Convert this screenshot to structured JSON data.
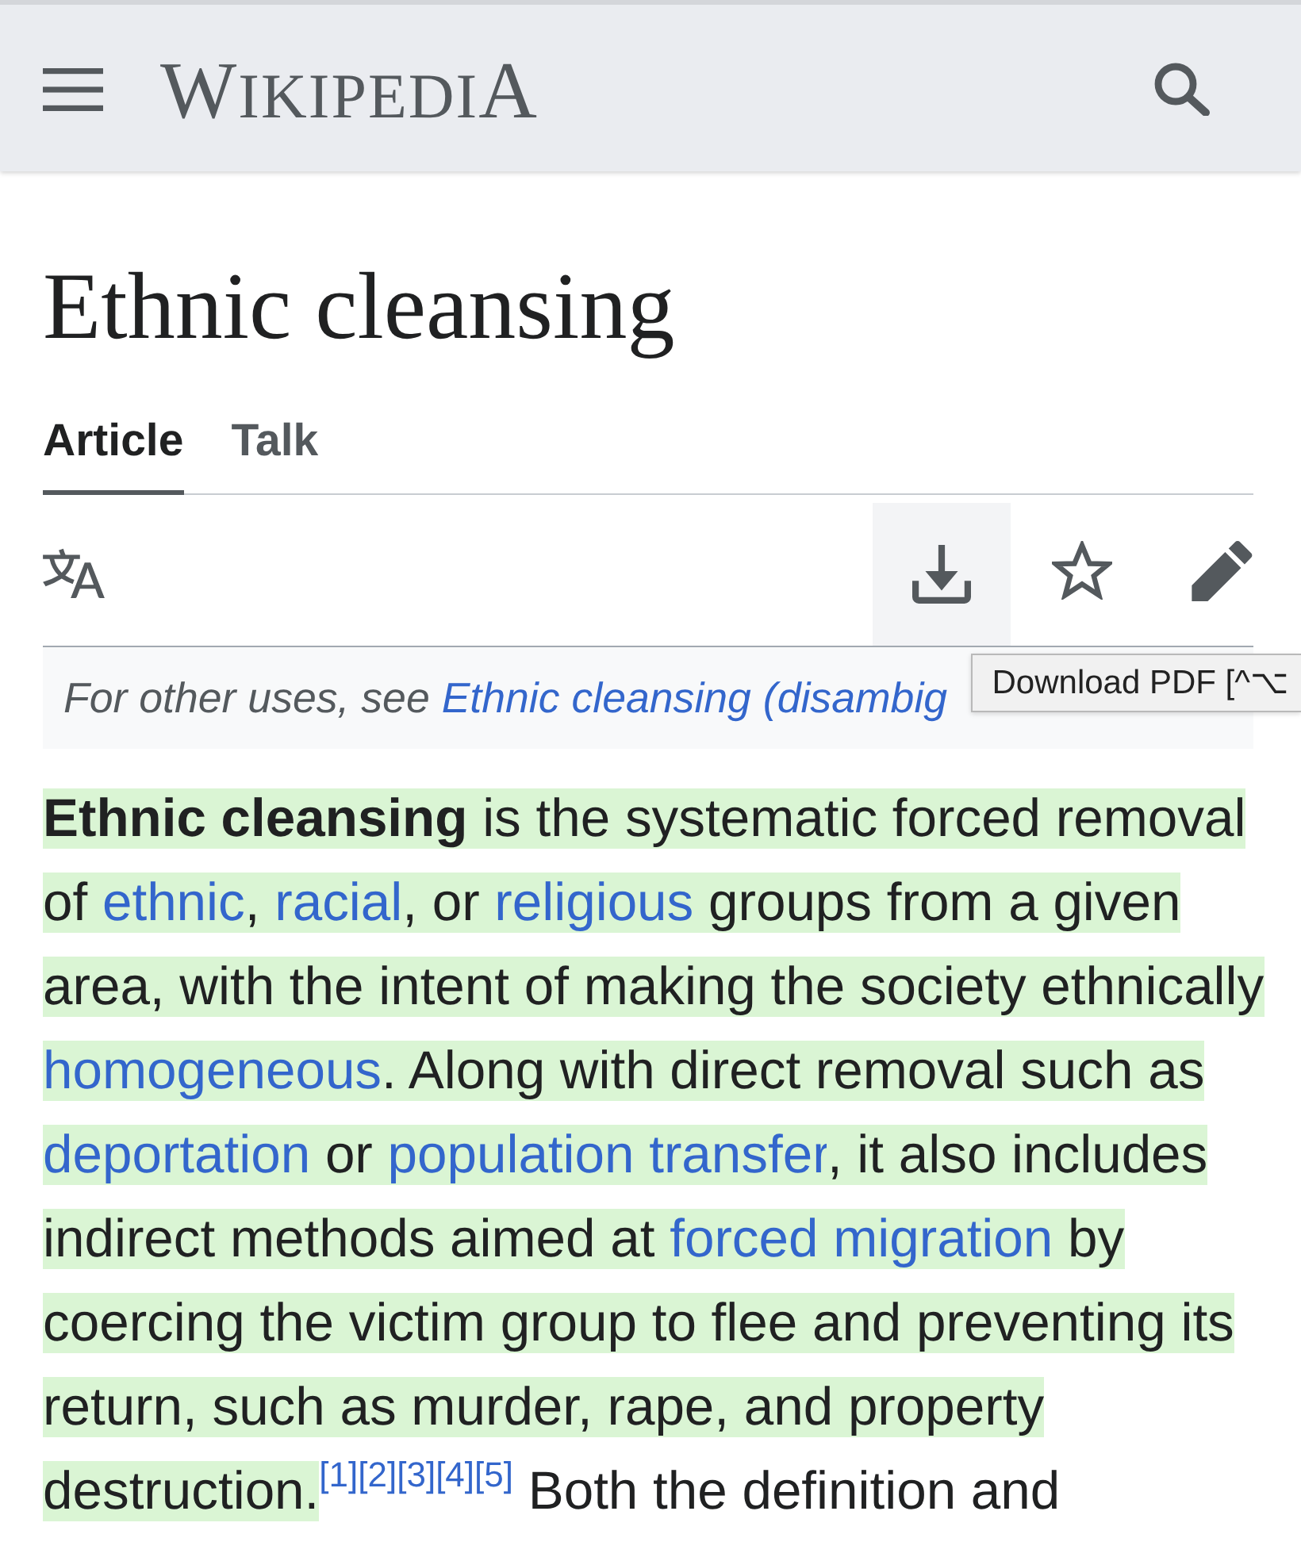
{
  "header": {
    "logo": "WIKIPEDIA"
  },
  "page": {
    "title": "Ethnic cleansing"
  },
  "tabs": [
    {
      "label": "Article",
      "selected": true
    },
    {
      "label": "Talk",
      "selected": false
    }
  ],
  "toolbar": {
    "download_hovered": true,
    "tooltip": "Download PDF [^⌥"
  },
  "hatnote": {
    "text": "For other uses, see ",
    "link": "Ethnic cleansing (disambig"
  },
  "lead_paragraph": [
    {
      "kind": "bold",
      "text": "Ethnic cleansing",
      "highlighted": true
    },
    {
      "kind": "text",
      "text": " is the systematic forced removal of ",
      "highlighted": true
    },
    {
      "kind": "link",
      "text": "ethnic",
      "highlighted": true
    },
    {
      "kind": "text",
      "text": ", ",
      "highlighted": true
    },
    {
      "kind": "link",
      "text": "racial",
      "highlighted": true
    },
    {
      "kind": "text",
      "text": ", or ",
      "highlighted": true
    },
    {
      "kind": "link",
      "text": "religious",
      "highlighted": true
    },
    {
      "kind": "text",
      "text": " groups from a given area, with the intent of making the society ethnically ",
      "highlighted": true
    },
    {
      "kind": "link",
      "text": "homogeneous",
      "highlighted": true
    },
    {
      "kind": "text",
      "text": ". Along with direct removal such as ",
      "highlighted": true
    },
    {
      "kind": "link",
      "text": "deportation",
      "highlighted": true
    },
    {
      "kind": "text",
      "text": " or ",
      "highlighted": true
    },
    {
      "kind": "link",
      "text": "population transfer",
      "highlighted": true
    },
    {
      "kind": "text",
      "text": ", it also includes indirect methods aimed at ",
      "highlighted": true
    },
    {
      "kind": "link",
      "text": "forced migration",
      "highlighted": true
    },
    {
      "kind": "text",
      "text": " by coercing the victim group to flee and preventing its return, such as murder, rape, and property destruction.",
      "highlighted": true
    },
    {
      "kind": "ref",
      "text": "[1]",
      "highlighted": false
    },
    {
      "kind": "ref",
      "text": "[2]",
      "highlighted": false
    },
    {
      "kind": "ref",
      "text": "[3]",
      "highlighted": false
    },
    {
      "kind": "ref",
      "text": "[4]",
      "highlighted": false
    },
    {
      "kind": "ref",
      "text": "[5]",
      "highlighted": false
    },
    {
      "kind": "text",
      "text": " Both the definition and",
      "highlighted": false
    }
  ]
}
